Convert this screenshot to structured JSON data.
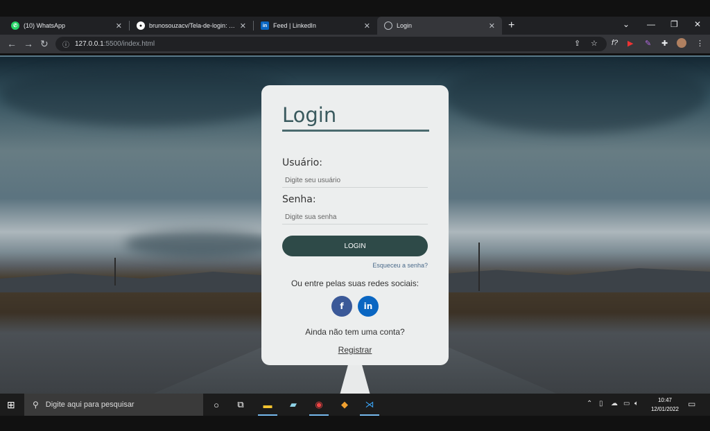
{
  "browser": {
    "tabs": [
      {
        "label": "(10) WhatsApp",
        "icon": "whatsapp-icon"
      },
      {
        "label": "brunosouzacv/Tela-de-login: Tela",
        "icon": "github-icon"
      },
      {
        "label": "Feed | LinkedIn",
        "icon": "linkedin-icon"
      },
      {
        "label": "Login",
        "icon": "globe-icon",
        "active": true
      }
    ],
    "url_host": "127.0.0.1",
    "url_path": ":5500/index.html"
  },
  "login": {
    "title": "Login",
    "username_label": "Usuário:",
    "username_placeholder": "Digite seu usuário",
    "password_label": "Senha:",
    "password_placeholder": "Digite sua senha",
    "login_button": "LOGIN",
    "forgot": "Esqueceu a senha?",
    "social_text": "Ou entre pelas suas redes sociais:",
    "facebook": "f",
    "linkedin": "in",
    "no_account": "Ainda não tem uma conta?",
    "register": "Registrar"
  },
  "taskbar": {
    "search_placeholder": "Digite aqui para pesquisar",
    "time": "10:47",
    "date": "12/01/2022"
  }
}
